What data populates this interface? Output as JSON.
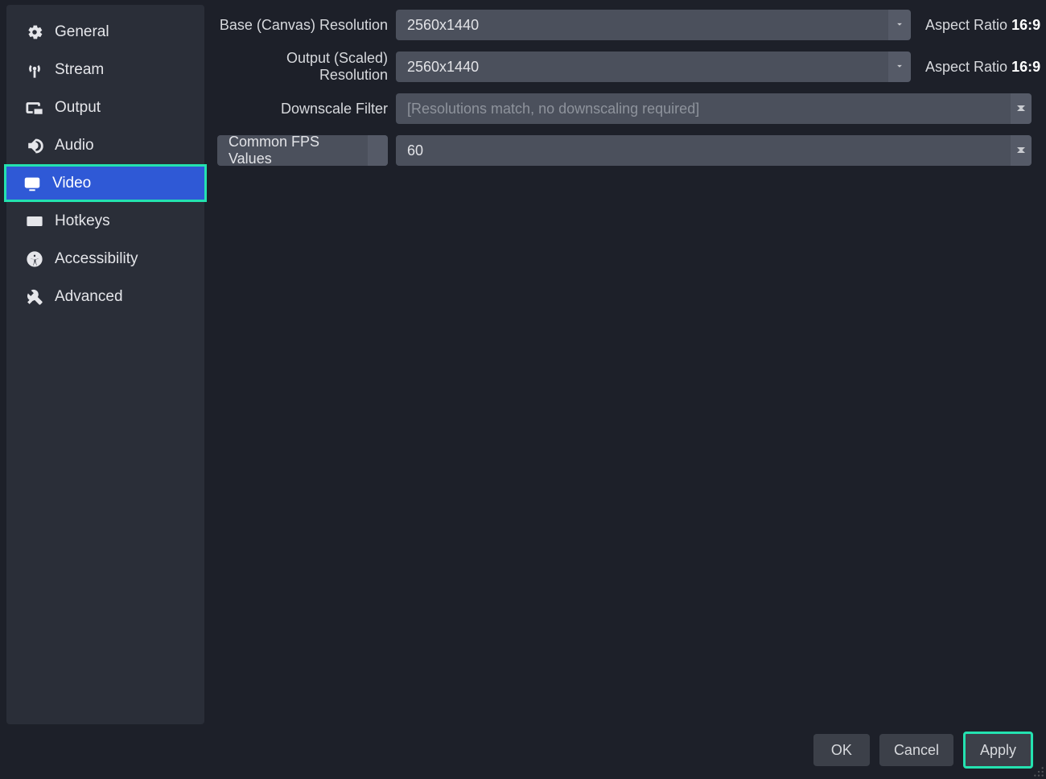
{
  "sidebar": {
    "items": [
      {
        "id": "general",
        "label": "General",
        "icon": "gear-icon"
      },
      {
        "id": "stream",
        "label": "Stream",
        "icon": "antenna-icon"
      },
      {
        "id": "output",
        "label": "Output",
        "icon": "output-icon"
      },
      {
        "id": "audio",
        "label": "Audio",
        "icon": "speaker-icon"
      },
      {
        "id": "video",
        "label": "Video",
        "icon": "monitor-icon",
        "selected": true
      },
      {
        "id": "hotkeys",
        "label": "Hotkeys",
        "icon": "keyboard-icon"
      },
      {
        "id": "accessibility",
        "label": "Accessibility",
        "icon": "accessibility-icon"
      },
      {
        "id": "advanced",
        "label": "Advanced",
        "icon": "tools-icon"
      }
    ]
  },
  "settings": {
    "base_resolution": {
      "label": "Base (Canvas) Resolution",
      "value": "2560x1440",
      "aspect_label": "Aspect Ratio",
      "aspect_value": "16:9"
    },
    "output_resolution": {
      "label": "Output (Scaled) Resolution",
      "value": "2560x1440",
      "aspect_label": "Aspect Ratio",
      "aspect_value": "16:9"
    },
    "downscale_filter": {
      "label": "Downscale Filter",
      "value": "[Resolutions match, no downscaling required]"
    },
    "fps": {
      "mode_label": "Common FPS Values",
      "value": "60"
    }
  },
  "footer": {
    "ok": "OK",
    "cancel": "Cancel",
    "apply": "Apply"
  }
}
